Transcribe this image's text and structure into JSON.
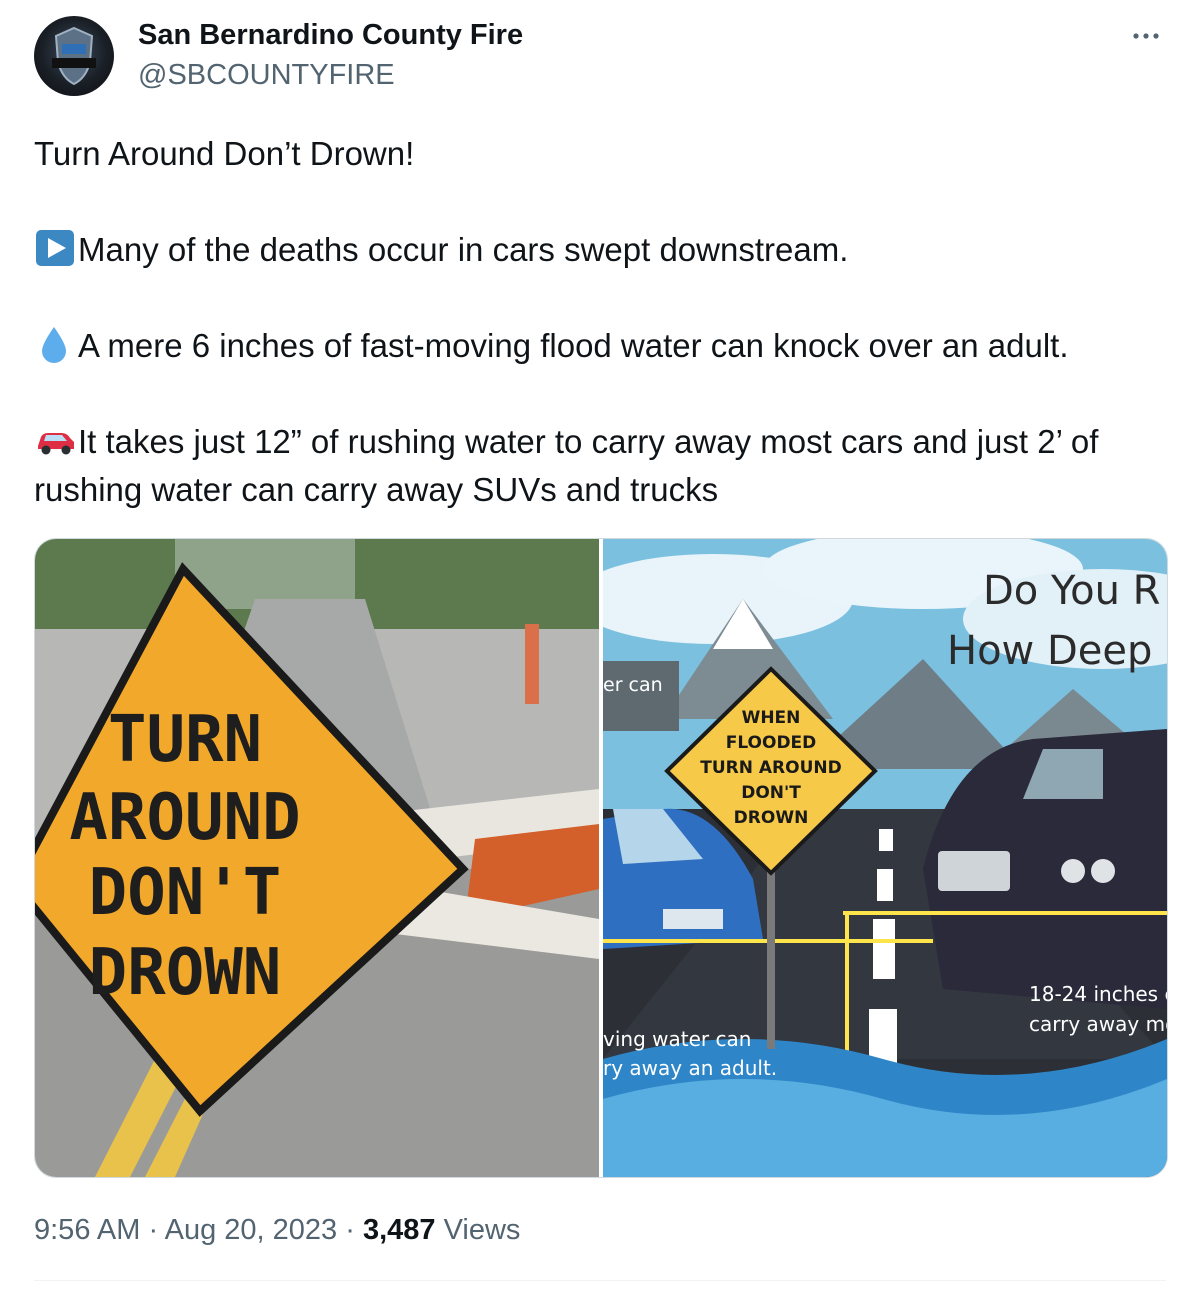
{
  "tweet": {
    "author_name": "San Bernardino County Fire",
    "author_handle": "@SBCOUNTYFIRE",
    "headline": "Turn Around Don’t Drown!",
    "points": [
      {
        "icon": "play-button-emoji",
        "text": "Many of the deaths occur in cars swept downstream."
      },
      {
        "icon": "droplet-emoji",
        "text": "A mere 6 inches of fast-moving flood water can knock over an adult."
      },
      {
        "icon": "car-emoji",
        "text": "It takes just 12” of rushing water to carry away most cars and just 2’ of rushing water can carry away SUVs and trucks"
      }
    ],
    "time": "9:56 AM",
    "separator": "·",
    "date": "Aug 20, 2023",
    "views_count": "3,487",
    "views_label": "Views"
  },
  "media": {
    "left_sign": {
      "line1": "TURN",
      "line2": "AROUND",
      "line3": "DON'T",
      "line4": "DROWN"
    },
    "right": {
      "title_line1": "Do You R",
      "title_line2": "How Deep",
      "sign": {
        "line1": "WHEN",
        "line2": "FLOODED",
        "line3": "TURN AROUND",
        "line4": "DON'T",
        "line5": "DROWN"
      },
      "box_top": "er can",
      "caption_left_1": "ving water can",
      "caption_left_2": "ry away an adult.",
      "caption_right_1": "18-24 inches c",
      "caption_right_2": "carry away mo"
    }
  },
  "colors": {
    "text": "#0f1419",
    "secondary": "#536471",
    "border": "#cfd9de",
    "sign_yellow": "#f2a92b"
  }
}
